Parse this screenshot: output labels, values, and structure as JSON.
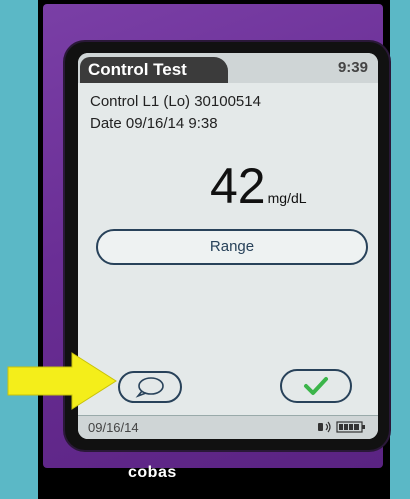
{
  "header": {
    "title": "Control Test",
    "time": "9:39"
  },
  "result": {
    "control_line": "Control L1 (Lo) 30100514",
    "date_line": "Date 09/16/14  9:38",
    "value": "42",
    "unit": "mg/dL"
  },
  "buttons": {
    "range_label": "Range",
    "comment_icon": "speech-bubble-icon",
    "confirm_icon": "checkmark-icon"
  },
  "status_bar": {
    "date": "09/16/14",
    "icons": [
      "wireless-icon",
      "battery-icon"
    ]
  },
  "device": {
    "brand": "cobas"
  },
  "colors": {
    "accent_check": "#3bb54a",
    "arrow": "#f4ee1a",
    "device_purple": "#6a2e95"
  }
}
